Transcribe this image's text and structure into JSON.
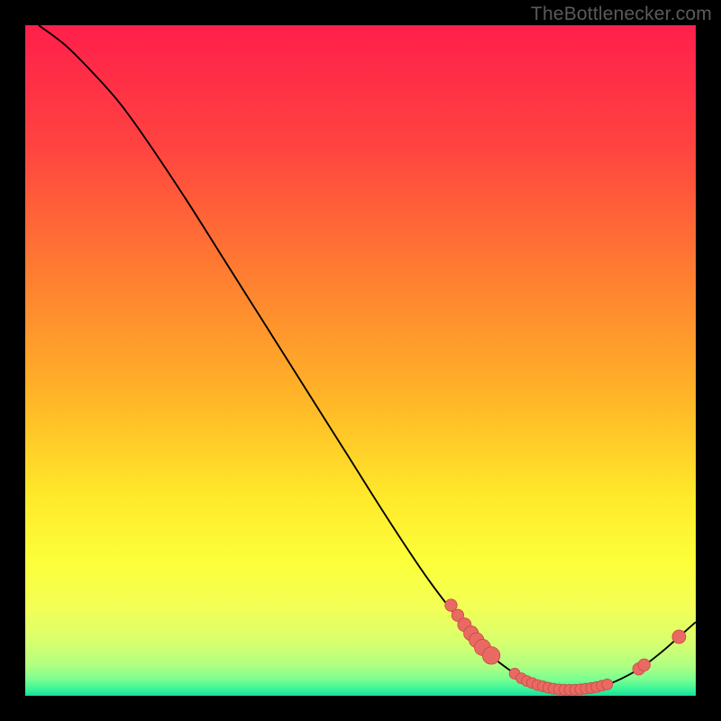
{
  "watermark": "TheBottlenecker.com",
  "colors": {
    "dot": "#e86a62",
    "dot_stroke": "#cc4d46",
    "line": "#000000"
  },
  "gradient_stops": [
    {
      "offset": 0.0,
      "color": "#ff1f4b"
    },
    {
      "offset": 0.18,
      "color": "#ff4340"
    },
    {
      "offset": 0.36,
      "color": "#ff7a32"
    },
    {
      "offset": 0.55,
      "color": "#ffb327"
    },
    {
      "offset": 0.7,
      "color": "#ffe82a"
    },
    {
      "offset": 0.8,
      "color": "#fcff3a"
    },
    {
      "offset": 0.87,
      "color": "#f2ff57"
    },
    {
      "offset": 0.92,
      "color": "#d7ff6e"
    },
    {
      "offset": 0.955,
      "color": "#b0ff82"
    },
    {
      "offset": 0.975,
      "color": "#7cff90"
    },
    {
      "offset": 0.99,
      "color": "#3cf59a"
    },
    {
      "offset": 1.0,
      "color": "#18dd9d"
    }
  ],
  "chart_data": {
    "type": "line",
    "title": "",
    "xlabel": "",
    "ylabel": "",
    "xlim": [
      0,
      100
    ],
    "ylim": [
      0,
      100
    ],
    "series": [
      {
        "name": "curve",
        "points": [
          {
            "x": 2,
            "y": 100
          },
          {
            "x": 6,
            "y": 97
          },
          {
            "x": 10,
            "y": 93
          },
          {
            "x": 14,
            "y": 88.5
          },
          {
            "x": 18,
            "y": 83
          },
          {
            "x": 24,
            "y": 74
          },
          {
            "x": 30,
            "y": 64.5
          },
          {
            "x": 36,
            "y": 55
          },
          {
            "x": 42,
            "y": 45.5
          },
          {
            "x": 48,
            "y": 36
          },
          {
            "x": 54,
            "y": 26.5
          },
          {
            "x": 60,
            "y": 17.5
          },
          {
            "x": 65,
            "y": 11
          },
          {
            "x": 69,
            "y": 6.5
          },
          {
            "x": 72,
            "y": 4
          },
          {
            "x": 75,
            "y": 2.2
          },
          {
            "x": 78,
            "y": 1.2
          },
          {
            "x": 80,
            "y": 0.9
          },
          {
            "x": 83,
            "y": 0.9
          },
          {
            "x": 86,
            "y": 1.4
          },
          {
            "x": 89,
            "y": 2.6
          },
          {
            "x": 92,
            "y": 4.3
          },
          {
            "x": 95,
            "y": 6.6
          },
          {
            "x": 97.5,
            "y": 8.8
          },
          {
            "x": 100,
            "y": 11
          }
        ]
      }
    ],
    "dots": [
      {
        "x": 63.5,
        "y": 13.5,
        "r": 0.9
      },
      {
        "x": 64.5,
        "y": 12.0,
        "r": 0.9
      },
      {
        "x": 65.5,
        "y": 10.6,
        "r": 1.0
      },
      {
        "x": 66.5,
        "y": 9.3,
        "r": 1.1
      },
      {
        "x": 67.3,
        "y": 8.3,
        "r": 1.1
      },
      {
        "x": 68.2,
        "y": 7.2,
        "r": 1.2
      },
      {
        "x": 69.5,
        "y": 6.0,
        "r": 1.3
      },
      {
        "x": 73.0,
        "y": 3.3,
        "r": 0.8
      },
      {
        "x": 74.0,
        "y": 2.6,
        "r": 0.8
      },
      {
        "x": 74.8,
        "y": 2.2,
        "r": 0.8
      },
      {
        "x": 75.6,
        "y": 1.9,
        "r": 0.8
      },
      {
        "x": 76.4,
        "y": 1.6,
        "r": 0.8
      },
      {
        "x": 77.2,
        "y": 1.4,
        "r": 0.8
      },
      {
        "x": 78.0,
        "y": 1.2,
        "r": 0.8
      },
      {
        "x": 78.8,
        "y": 1.05,
        "r": 0.8
      },
      {
        "x": 79.6,
        "y": 0.95,
        "r": 0.8
      },
      {
        "x": 80.4,
        "y": 0.9,
        "r": 0.8
      },
      {
        "x": 81.2,
        "y": 0.9,
        "r": 0.8
      },
      {
        "x": 82.0,
        "y": 0.9,
        "r": 0.8
      },
      {
        "x": 82.8,
        "y": 0.95,
        "r": 0.8
      },
      {
        "x": 83.6,
        "y": 1.05,
        "r": 0.8
      },
      {
        "x": 84.4,
        "y": 1.15,
        "r": 0.8
      },
      {
        "x": 85.2,
        "y": 1.3,
        "r": 0.8
      },
      {
        "x": 86.0,
        "y": 1.5,
        "r": 0.8
      },
      {
        "x": 86.8,
        "y": 1.7,
        "r": 0.8
      },
      {
        "x": 91.5,
        "y": 4.0,
        "r": 0.9
      },
      {
        "x": 92.3,
        "y": 4.6,
        "r": 0.9
      },
      {
        "x": 97.5,
        "y": 8.8,
        "r": 1.0
      }
    ]
  }
}
